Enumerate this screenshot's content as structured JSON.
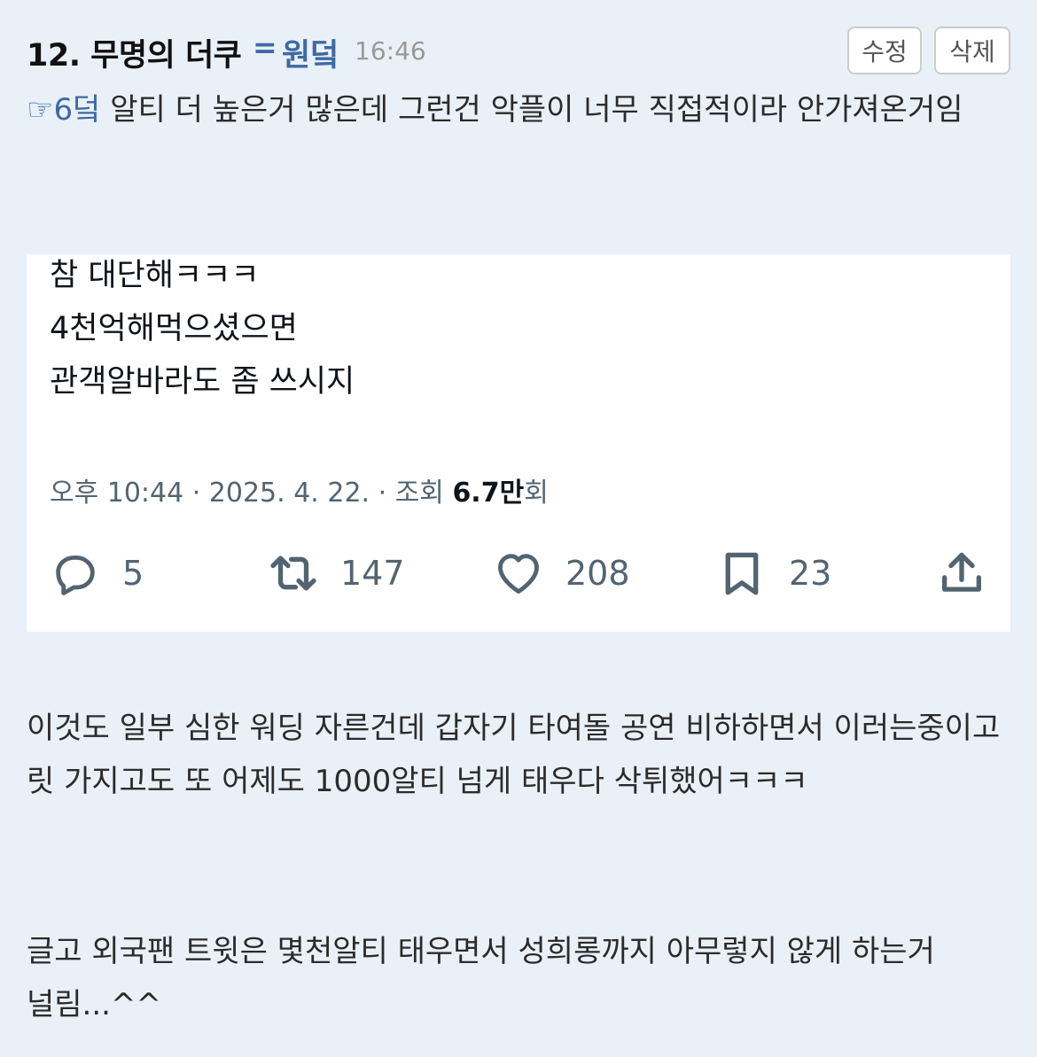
{
  "comment": {
    "author": "12. 무명의 더쿠",
    "op_marker": "=",
    "op_label": "원덬",
    "time": "16:46",
    "edit_label": "수정",
    "delete_label": "삭제"
  },
  "body": {
    "reply_ref": "☞6덬",
    "paragraph1": " 알티 더 높은거 많은데 그런건 악플이 너무 직접적이라 안가져온거임",
    "paragraph2": "이것도 일부 심한 워딩 자른건데 갑자기 타여돌 공연 비하하면서 이러는중이고 릿 가지고도 또 어제도 1000알티 넘게 태우다 삭튀했어ㅋㅋㅋ",
    "paragraph3": "글고 외국팬 트윗은 몇천알티 태우면서 성희롱까지 아무렇지 않게 하는거 널림...^^"
  },
  "tweet": {
    "lines": [
      "참 대단해ㅋㅋㅋ",
      "4천억해먹으셨으면",
      "관객알바라도 좀 쓰시지"
    ],
    "timestamp": "오후 10:44 · 2025. 4. 22. · 조회 ",
    "views_number": "6.7만",
    "views_suffix": "회",
    "actions": {
      "replies": "5",
      "retweets": "147",
      "likes": "208",
      "bookmarks": "23"
    }
  },
  "icons": {
    "reply": "speech-bubble-icon",
    "retweet": "retweet-arrows-icon",
    "like": "heart-icon",
    "bookmark": "bookmark-icon",
    "share": "share-upload-icon"
  },
  "colors": {
    "background": "#e9f0f8",
    "accent": "#3d6aa3",
    "muted": "#536471"
  }
}
